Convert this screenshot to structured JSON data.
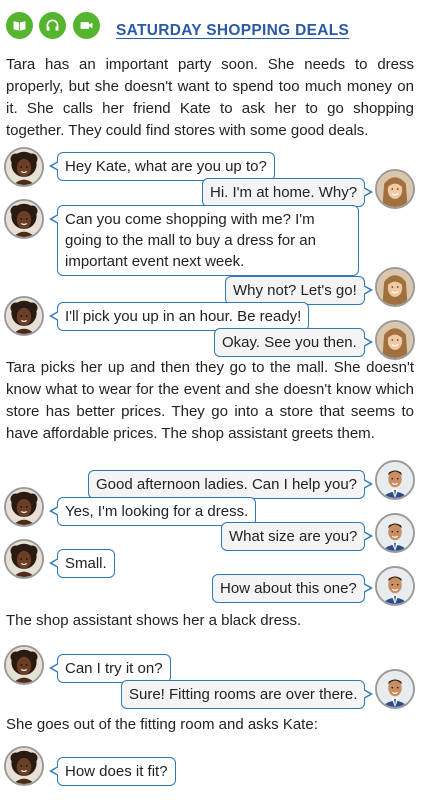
{
  "header": {
    "title": "SATURDAY SHOPPING DEALS",
    "icons": [
      "book-icon",
      "headphones-icon",
      "video-camera-icon"
    ],
    "accent_color": "#55b52e",
    "title_color": "#2a5aa6"
  },
  "narration": [
    "Tara has an important party soon. She needs to dress properly, but she doesn't want to spend too much money on it. She calls her friend Kate to ask her to go shopping together. They could find stores with some good deals.",
    "Tara picks her up and then they go to the mall. She doesn't know what to wear for the event and she doesn't know which store has better prices. They go into a store that seems to have affordable prices. The shop assistant greets them.",
    "The shop assistant shows her a black dress.",
    "She goes out of the fitting room and asks Kate:"
  ],
  "dialogue": [
    {
      "speaker": "tara",
      "text": "Hey Kate, what are you up to?"
    },
    {
      "speaker": "kate",
      "text": "Hi. I'm at home. Why?"
    },
    {
      "speaker": "tara",
      "text": "Can you come shopping with me? I'm going to the mall to buy a dress for an important event next week."
    },
    {
      "speaker": "kate",
      "text": "Why not? Let's go!"
    },
    {
      "speaker": "tara",
      "text": "I'll pick you up in an hour. Be ready!"
    },
    {
      "speaker": "kate",
      "text": "Okay. See you then."
    },
    {
      "speaker": "assistant",
      "text": "Good afternoon ladies. Can I help you?"
    },
    {
      "speaker": "tara",
      "text": "Yes, I'm looking for a dress."
    },
    {
      "speaker": "assistant",
      "text": "What size are you?"
    },
    {
      "speaker": "tara",
      "text": "Small."
    },
    {
      "speaker": "assistant",
      "text": "How about this one?"
    },
    {
      "speaker": "tara",
      "text": "Can I try it on?"
    },
    {
      "speaker": "assistant",
      "text": "Sure! Fitting rooms are over there."
    },
    {
      "speaker": "tara",
      "text": "How does it fit?"
    }
  ],
  "colors": {
    "bubble_border": "#2f79b6",
    "right_bubble_fill": "#f4f4f4"
  }
}
